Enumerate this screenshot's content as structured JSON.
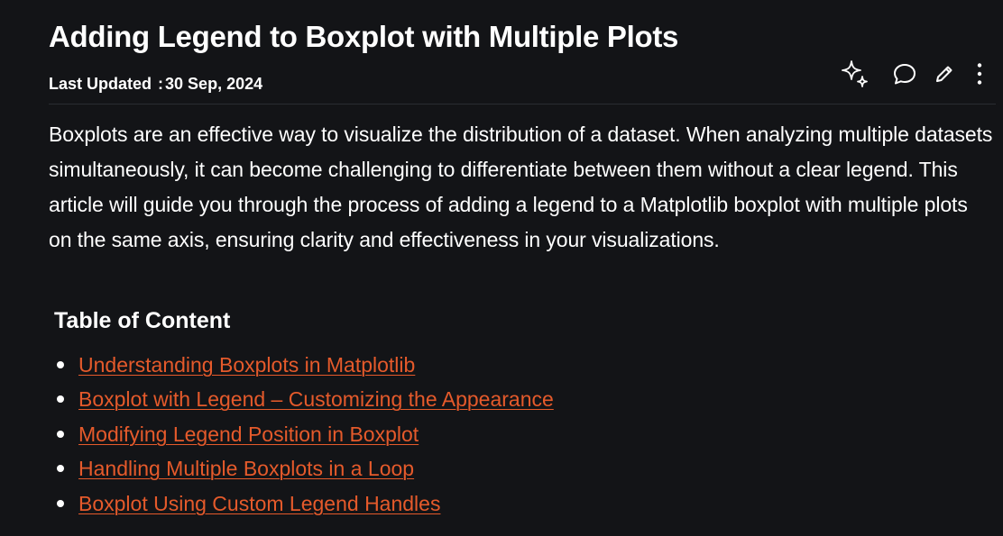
{
  "article": {
    "title": "Adding Legend to Boxplot with Multiple Plots",
    "meta": {
      "label": "Last Updated",
      "separator": ":",
      "date": "30 Sep, 2024"
    },
    "intro": "Boxplots are an effective way to visualize the distribution of a dataset. When analyzing multiple datasets simultaneously, it can become challenging to differentiate between them without a clear legend. This article will guide you through the process of adding a legend to a Matplotlib boxplot with multiple plots on the same axis, ensuring clarity and effectiveness in your visualizations."
  },
  "actions": [
    {
      "icon": "sparkle-icon"
    },
    {
      "icon": "comment-icon"
    },
    {
      "icon": "pencil-icon"
    },
    {
      "icon": "more-vertical-icon"
    }
  ],
  "toc": {
    "heading": "Table of Content",
    "items": [
      {
        "label": "Understanding Boxplots in Matplotlib"
      },
      {
        "label": "Boxplot with Legend – Customizing the Appearance"
      },
      {
        "label": "Modifying Legend Position in Boxplot"
      },
      {
        "label": "Handling Multiple Boxplots in a Loop"
      },
      {
        "label": "Boxplot Using Custom Legend Handles"
      }
    ]
  },
  "colors": {
    "background": "#131417",
    "text": "#ffffff",
    "link": "#e55a2b",
    "divider": "#2a2c31"
  }
}
